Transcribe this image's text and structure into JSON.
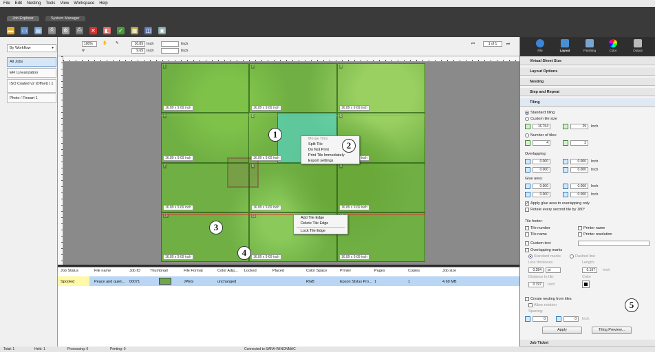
{
  "menu": [
    "File",
    "Edit",
    "Nesting",
    "Tools",
    "View",
    "Workspace",
    "Help"
  ],
  "tabs": [
    "Job Explorer",
    "System Manager"
  ],
  "left": {
    "workflow": "By Workflow",
    "queues": [
      "All Jobs",
      "EFI Linearization",
      "ISO Coated v2 (Offset) | 1",
      "Photo / Fineart 1"
    ]
  },
  "nav": {
    "zoom": "100%",
    "width": "16.89",
    "height": "9.69",
    "unit": "Inch",
    "page": "1 of 1"
  },
  "tiles": [
    {
      "n": "1",
      "size": "16.89 x 9.69 inch"
    },
    {
      "n": "2",
      "size": "16.89 x 9.69 inch"
    },
    {
      "n": "3",
      "size": "16.89 x 9.69 inch"
    },
    {
      "n": "4",
      "size": "16.89 x 9.69 inch"
    },
    {
      "n": "5",
      "size": "16.89 x 9.69 inch"
    },
    {
      "n": "6",
      "size": "16.89 x 9.69 inch"
    },
    {
      "n": "7",
      "size": "16.89 x 9.69 inch"
    },
    {
      "n": "8",
      "size": "16.89 x 9.69 inch"
    },
    {
      "n": "9",
      "size": "16.89 x 9.69 inch"
    },
    {
      "n": "10",
      "size": "16.89 x 9.69 inch"
    },
    {
      "n": "11",
      "size": "16.89 x 9.69 inch"
    },
    {
      "n": "12",
      "size": "16.89 x 9.69 inch"
    }
  ],
  "ctx1": [
    "Merge Tiles",
    "Split Tile",
    "Do Not Print",
    "Print Tile Immediately",
    "Export settings"
  ],
  "ctx2": [
    "Add Tile Edge",
    "Delete Tile Edge",
    "Lock Tile Edge"
  ],
  "callouts": [
    "1",
    "2",
    "3",
    "4",
    "5"
  ],
  "table": {
    "headers": [
      "Job Status",
      "File name",
      "Job ID",
      "Thumbnail",
      "File Format",
      "Color Adju...",
      "Locked",
      "Placed",
      "Color Space",
      "Printer",
      "Pages",
      "Copies",
      "Job size"
    ],
    "row": {
      "status": "Spooled",
      "file": "Peace and quiet...",
      "id": "00071",
      "format": "JPEG",
      "color": "unchanged",
      "space": "RGB",
      "printer": "Epson Stylus Pro...",
      "pages": "1",
      "copies": "1",
      "size": "4.69 MB"
    }
  },
  "status": {
    "total": "Total: 1",
    "held": "Held: 1",
    "processing": "Processing: 0",
    "printing": "Printing: 0",
    "connected": "Connected to SARA-WINONMAC"
  },
  "right": {
    "tabs": [
      "File",
      "Layout",
      "Finishing",
      "Color",
      "Output"
    ],
    "sections": [
      "Virtual Sheet Size",
      "Layout Options",
      "Nesting",
      "Step and Repeat",
      "Tiling"
    ],
    "standard": "Standard tiling",
    "custom": "Custom tile size",
    "tw": "16.764",
    "th": "29",
    "unit": "Inch",
    "numtiles": "Number of tiles:",
    "nx": "4",
    "ny": "3",
    "overlap": "Overlapping:",
    "ov": [
      "0.000",
      "0.000",
      "0.000",
      "0.000"
    ],
    "glue": "Glue area:",
    "gl": [
      "0.000",
      "0.000",
      "0.000",
      "0.000"
    ],
    "applyglue": "Apply glue area to overlapping only",
    "rotate": "Rotate every second tile by 180°",
    "footer": "Tile footer:",
    "tilenum": "Tile number",
    "tilename": "Tile name",
    "customtext": "Custom text",
    "printername": "Printer name",
    "printerres": "Printer resolution",
    "overmarks": "Overlapping marks",
    "stdmarks": "Standard marks",
    "dashed": "Dashed line",
    "thick": "Line thickness:",
    "thickv": "0.284",
    "pt": "pt",
    "length": "Length:",
    "lengthv": "0.197",
    "inch": "Inch",
    "dist": "Distance to tile:",
    "distv": "0.197",
    "colorlbl": "Color",
    "nest": "Create nesting from tiles",
    "allowrot": "Allow rotation",
    "spacing": "Spacing:",
    "sp1": "0",
    "sp2": "0",
    "apply": "Apply",
    "preview": "Tiling Preview...",
    "jobticket": "Job Ticket"
  }
}
